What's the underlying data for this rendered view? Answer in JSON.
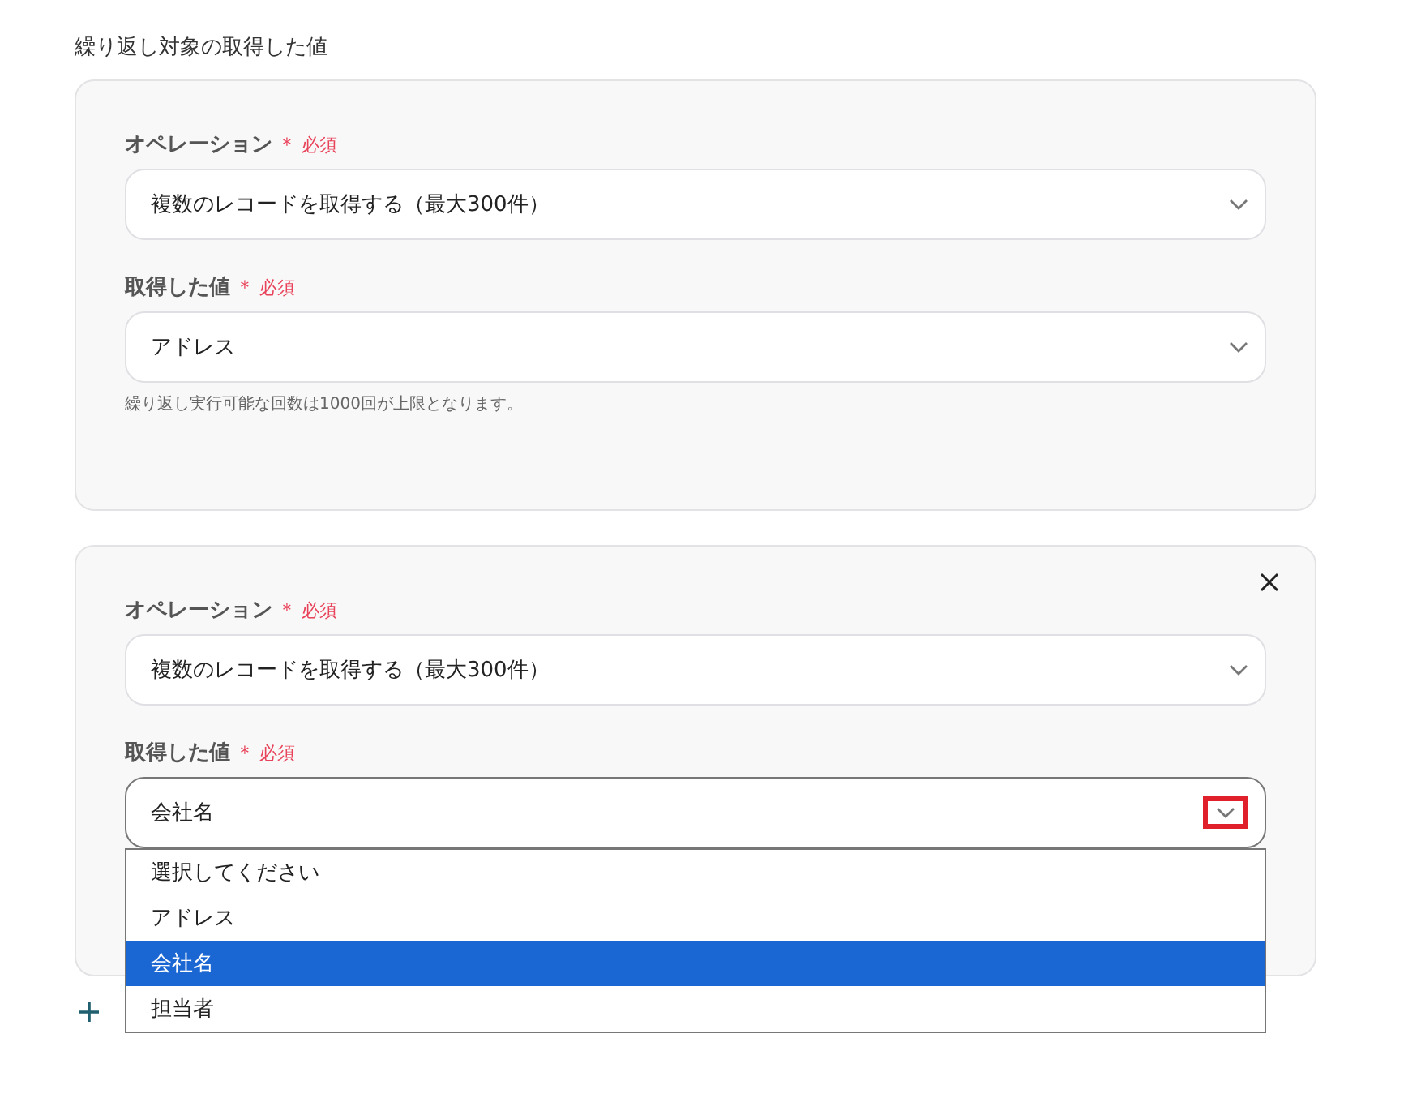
{
  "section_title": "繰り返し対象の取得した値",
  "groups": [
    {
      "removable": false,
      "fields": [
        {
          "label": "オペレーション",
          "required_mark": "＊",
          "required": "必須",
          "value": "複数のレコードを取得する（最大300件）",
          "focused": false,
          "highlighted": false
        },
        {
          "label": "取得した値",
          "required_mark": "＊",
          "required": "必須",
          "value": "アドレス",
          "focused": false,
          "highlighted": false,
          "hint": "繰り返し実行可能な回数は1000回が上限となります。"
        }
      ]
    },
    {
      "removable": true,
      "fields": [
        {
          "label": "オペレーション",
          "required_mark": "＊",
          "required": "必須",
          "value": "複数のレコードを取得する（最大300件）",
          "focused": false,
          "highlighted": false
        },
        {
          "label": "取得した値",
          "required_mark": "＊",
          "required": "必須",
          "value": "会社名",
          "focused": true,
          "highlighted": true,
          "options": [
            {
              "label": "選択してください",
              "selected": false
            },
            {
              "label": "アドレス",
              "selected": false
            },
            {
              "label": "会社名",
              "selected": true
            },
            {
              "label": "担当者",
              "selected": false
            }
          ]
        }
      ]
    }
  ],
  "add_button": {
    "kind": "plus"
  }
}
